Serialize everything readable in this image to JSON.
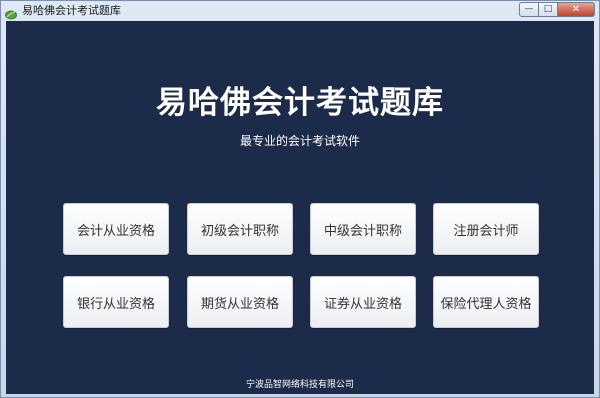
{
  "window": {
    "title": "易哈佛会计考试题库",
    "controls": {
      "minimize": "—",
      "maximize": "□",
      "close": "✕"
    }
  },
  "main": {
    "title": "易哈佛会计考试题库",
    "subtitle": "最专业的会计考试软件",
    "buttons": [
      {
        "label": "会计从业资格"
      },
      {
        "label": "初级会计职称"
      },
      {
        "label": "中级会计职称"
      },
      {
        "label": "注册会计师"
      },
      {
        "label": "银行从业资格"
      },
      {
        "label": "期货从业资格"
      },
      {
        "label": "证券从业资格"
      },
      {
        "label": "保险代理人资格"
      }
    ]
  },
  "footer": {
    "company": "宁波品智网络科技有限公司"
  },
  "colors": {
    "background": "#1d2b4b",
    "titlebar": "#dfe8f4",
    "close_button": "#c2432c"
  }
}
